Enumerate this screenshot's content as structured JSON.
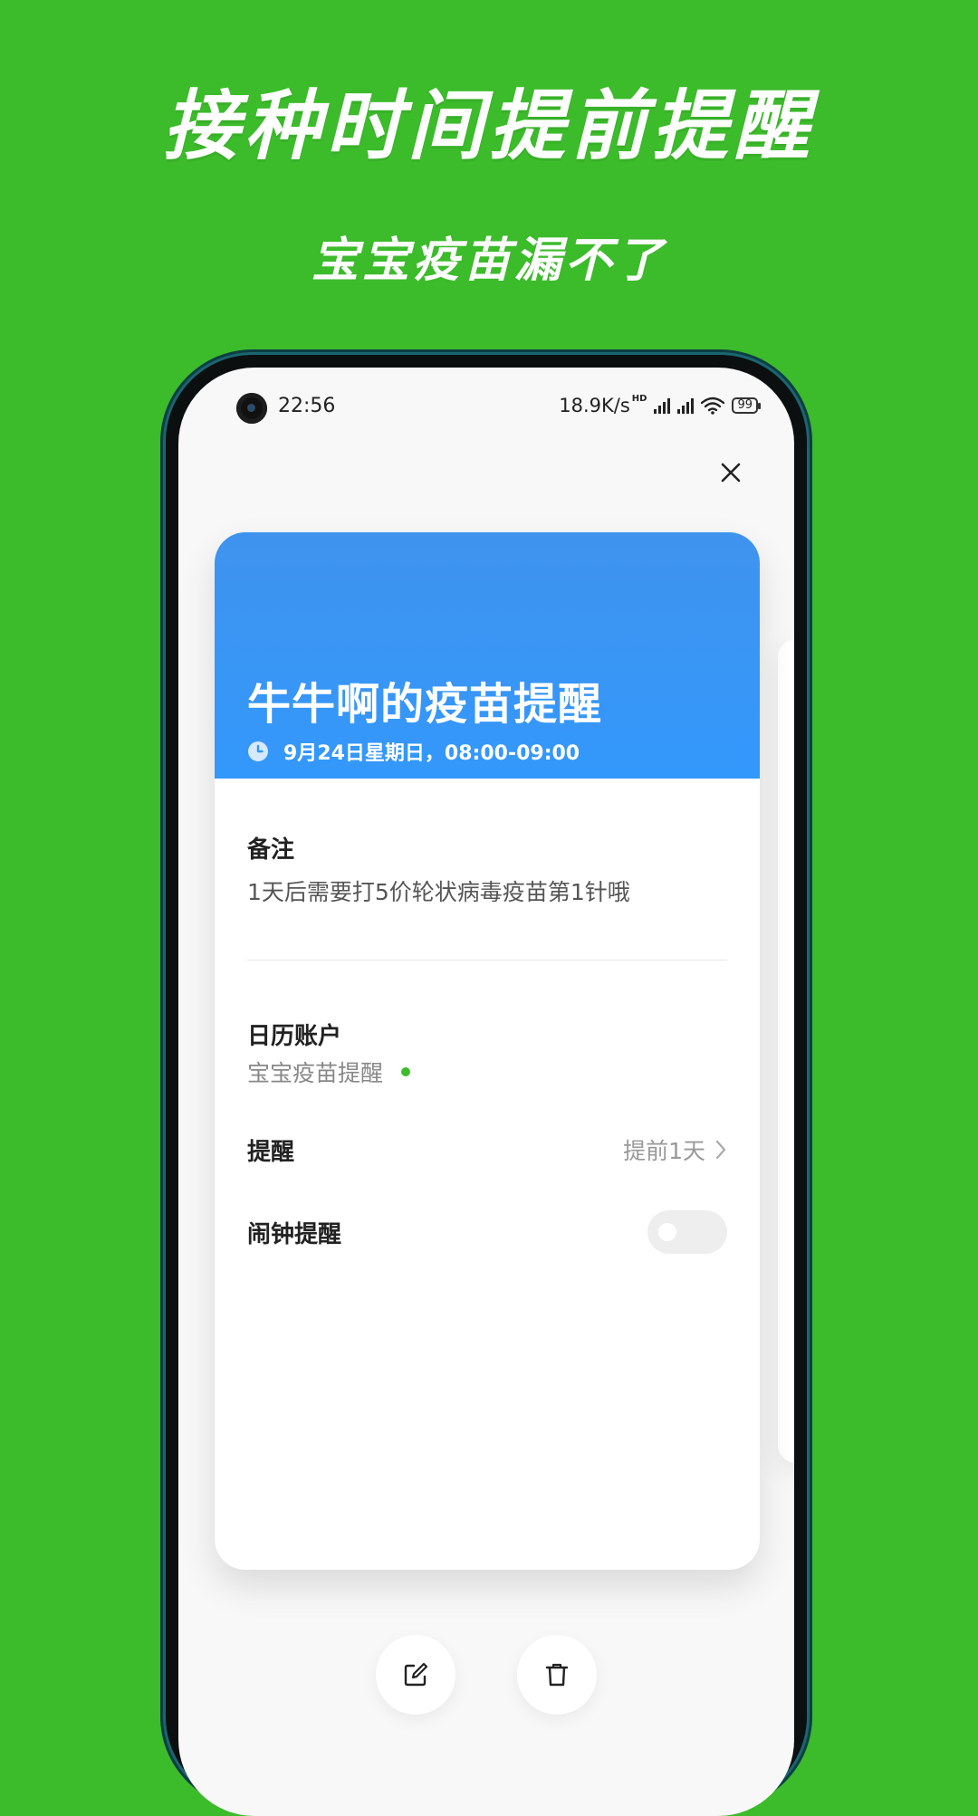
{
  "promo": {
    "title": "接种时间提前提醒",
    "subtitle": "宝宝疫苗漏不了"
  },
  "status_bar": {
    "time": "22:56",
    "network_speed": "18.9K/s",
    "network_badge": "HD",
    "battery": "99"
  },
  "event": {
    "title": "牛牛啊的疫苗提醒",
    "time": "9月24日星期日，08:00-09:00",
    "notes_label": "备注",
    "notes_text": "1天后需要打5价轮状病毒疫苗第1针哦",
    "account_label": "日历账户",
    "account_value": "宝宝疫苗提醒",
    "reminder_label": "提醒",
    "reminder_value": "提前1天",
    "alarm_label": "闹钟提醒",
    "alarm_enabled": false
  },
  "colors": {
    "background": "#3cbb2b",
    "card_header": "#3398fb",
    "account_dot": "#3cbb2b"
  },
  "icons": {
    "close": "close-icon",
    "clock": "clock-icon",
    "chevron": "chevron-right-icon",
    "edit": "edit-icon",
    "delete": "trash-icon"
  }
}
